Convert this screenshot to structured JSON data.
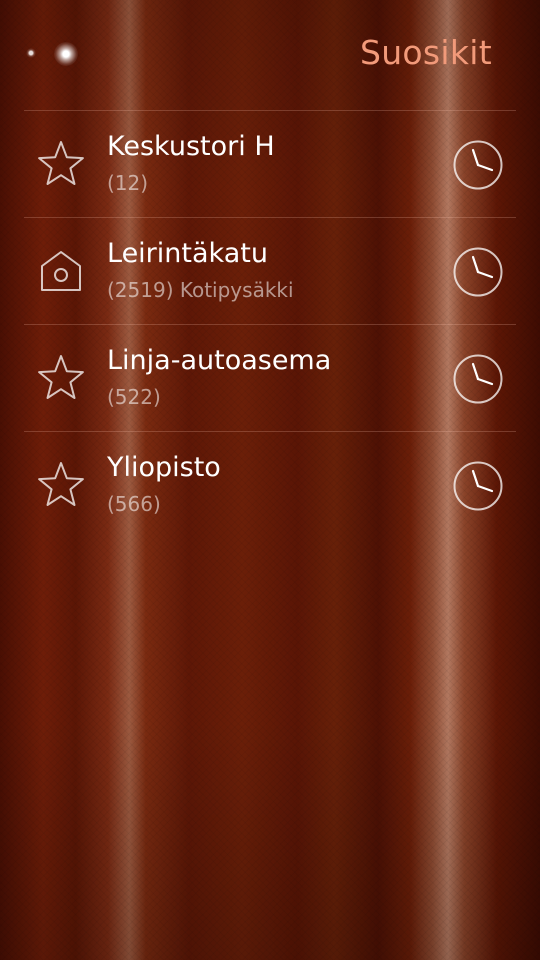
{
  "header": {
    "title": "Suosikit",
    "title_color": "#f29a7a"
  },
  "favorites": [
    {
      "name": "Keskustori H",
      "detail": "(12)",
      "icon": "star-icon"
    },
    {
      "name": "Leirintäkatu",
      "detail": "(2519) Kotipysäkki",
      "icon": "home-icon"
    },
    {
      "name": "Linja-autoasema",
      "detail": "(522)",
      "icon": "star-icon"
    },
    {
      "name": "Yliopisto",
      "detail": "(566)",
      "icon": "star-icon"
    }
  ],
  "row_action_icon": "clock-icon"
}
